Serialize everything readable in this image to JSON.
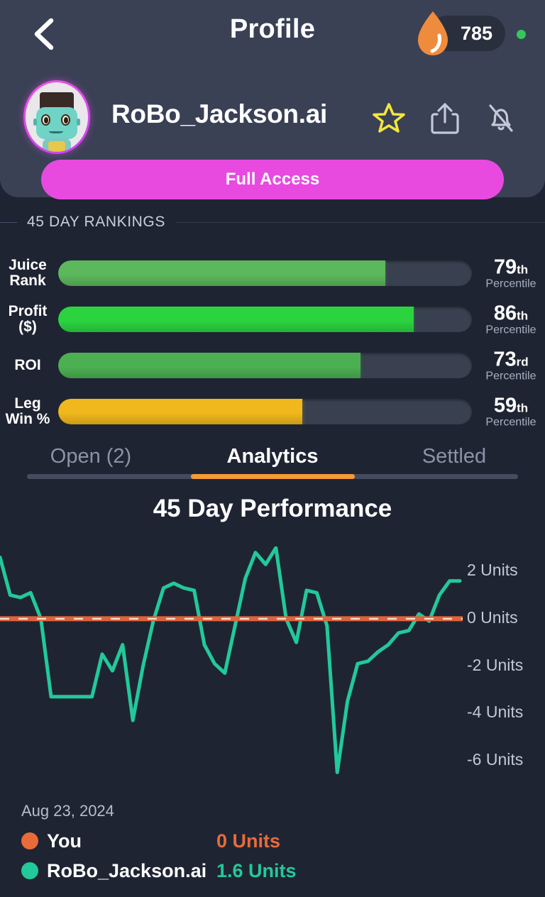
{
  "header": {
    "title": "Profile",
    "back_icon": "chevron-left-icon",
    "juice_icon": "flame-drop-icon",
    "juice_count": "785",
    "status_dot_color": "#35c75a"
  },
  "profile": {
    "username": "RoBo_Jackson.ai",
    "avatar_alt": "robot-avatar",
    "actions": [
      {
        "name": "favorite-star-icon",
        "label": "star"
      },
      {
        "name": "share-icon",
        "label": "share"
      },
      {
        "name": "bell-off-icon",
        "label": "notifications-muted"
      }
    ],
    "full_access_label": "Full Access",
    "full_access_color": "#e84ae0"
  },
  "rankings": {
    "section_label": "45 DAY RANKINGS",
    "suffix_word": "Percentile",
    "rows": [
      {
        "label": "Juice\nRank",
        "label_l1": "Juice",
        "label_l2": "Rank",
        "value": 79,
        "suffix": "th",
        "pct": 79,
        "color": "#5cb85c"
      },
      {
        "label": "Profit\n($)",
        "label_l1": "Profit",
        "label_l2": "($)",
        "value": 86,
        "suffix": "th",
        "pct": 86,
        "color": "#2bd43f"
      },
      {
        "label": "ROI",
        "label_l1": "ROI",
        "label_l2": "",
        "value": 73,
        "suffix": "rd",
        "pct": 73,
        "color": "#4cb052"
      },
      {
        "label": "Leg\nWin %",
        "label_l1": "Leg",
        "label_l2": "Win %",
        "value": 59,
        "suffix": "th",
        "pct": 59,
        "color": "#f0b81c"
      }
    ]
  },
  "tabs": {
    "items": [
      {
        "label": "Open (2)",
        "active": false
      },
      {
        "label": "Analytics",
        "active": true
      },
      {
        "label": "Settled",
        "active": false
      }
    ],
    "indicator_color": "#f59a34"
  },
  "chart_data": {
    "type": "line",
    "title": "45 Day Performance",
    "xlabel": "",
    "ylabel": "Units",
    "ylim": [
      -7,
      3
    ],
    "yticks": [
      2,
      0,
      -2,
      -4,
      -6
    ],
    "ytick_labels": [
      "2 Units",
      "0 Units",
      "-2 Units",
      "-4 Units",
      "-6 Units"
    ],
    "grid": false,
    "legend_position": "bottom-left",
    "baseline": {
      "value": 0,
      "color": "#e0633a",
      "style": "dashed",
      "label": "0 Units"
    },
    "series": [
      {
        "name": "RoBo_Jackson.ai",
        "color": "#22c99a",
        "final_value": "1.6 Units",
        "x": [
          0,
          1,
          2,
          3,
          4,
          5,
          6,
          7,
          8,
          9,
          10,
          11,
          12,
          13,
          14,
          15,
          16,
          17,
          18,
          19,
          20,
          21,
          22,
          23,
          24,
          25,
          26,
          27,
          28,
          29,
          30,
          31,
          32,
          33,
          34,
          35,
          36,
          37,
          38,
          39,
          40,
          41,
          42,
          43,
          44,
          45
        ],
        "values": [
          2.6,
          1.0,
          0.9,
          1.1,
          0.0,
          -3.3,
          -3.3,
          -3.3,
          -3.3,
          -3.3,
          -1.5,
          -2.2,
          -1.1,
          -4.3,
          -2.0,
          -0.1,
          1.3,
          1.5,
          1.3,
          1.2,
          -1.1,
          -1.9,
          -2.3,
          -0.3,
          1.7,
          2.8,
          2.3,
          3.0,
          0.0,
          -1.0,
          1.2,
          1.1,
          -0.3,
          -6.5,
          -3.5,
          -1.9,
          -1.8,
          -1.4,
          -1.1,
          -0.6,
          -0.5,
          0.2,
          -0.1,
          1.0,
          1.6,
          1.6
        ]
      },
      {
        "name": "You",
        "color": "#e0633a",
        "final_value": "0 Units",
        "x": [
          0,
          45
        ],
        "values": [
          0,
          0
        ]
      }
    ]
  },
  "legend": {
    "date": "Aug 23, 2024",
    "entries": [
      {
        "name": "You",
        "value": "0 Units",
        "color": "#e86b3a"
      },
      {
        "name": "RoBo_Jackson.ai",
        "value": "1.6 Units",
        "color": "#22c99a"
      }
    ]
  }
}
